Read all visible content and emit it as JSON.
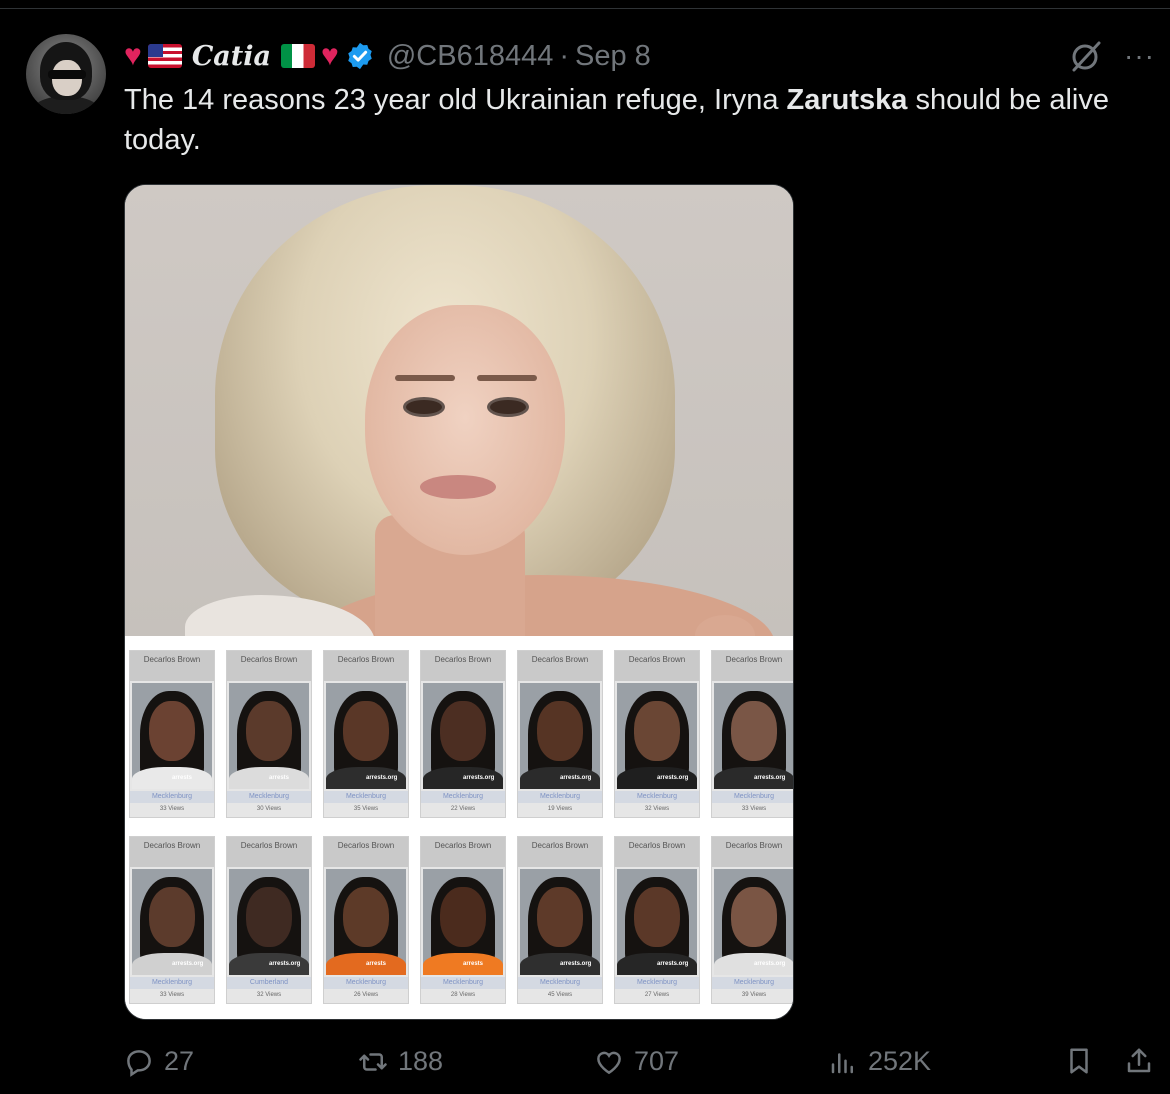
{
  "post": {
    "author_name": "Catia",
    "handle": "@CB618444",
    "separator": "·",
    "date": "Sep 8",
    "more_label": "···",
    "text_before": "The 14 reasons 23 year old Ukrainian refuge, Iryna ",
    "text_bold": "Zarutska",
    "text_after": " should be alive today."
  },
  "mugshots": [
    {
      "label": "Decarlos Brown",
      "watermark": "arrests",
      "county": "Mecklenburg",
      "views": "33 Views",
      "skin": "#6b4232",
      "shirt": "#e9e9e9"
    },
    {
      "label": "Decarlos Brown",
      "watermark": "arrests",
      "county": "Mecklenburg",
      "views": "30 Views",
      "skin": "#5b3a2b",
      "shirt": "#dcdcdc"
    },
    {
      "label": "Decarlos Brown",
      "watermark": "arrests.org",
      "county": "Mecklenburg",
      "views": "35 Views",
      "skin": "#5a3727",
      "shirt": "#2d2d2d"
    },
    {
      "label": "Decarlos Brown",
      "watermark": "arrests.org",
      "county": "Mecklenburg",
      "views": "22 Views",
      "skin": "#4c2e22",
      "shirt": "#262626"
    },
    {
      "label": "Decarlos Brown",
      "watermark": "arrests.org",
      "county": "Mecklenburg",
      "views": "19 Views",
      "skin": "#563424",
      "shirt": "#2b2b2b"
    },
    {
      "label": "Decarlos Brown",
      "watermark": "arrests.org",
      "county": "Mecklenburg",
      "views": "32 Views",
      "skin": "#6a4634",
      "shirt": "#1f1f1f"
    },
    {
      "label": "Decarlos Brown",
      "watermark": "arrests.org",
      "county": "Mecklenburg",
      "views": "33 Views",
      "skin": "#7a5646",
      "shirt": "#2a2a2a"
    },
    {
      "label": "Decarlos Brown",
      "watermark": "arrests.org",
      "county": "Mecklenburg",
      "views": "33 Views",
      "skin": "#5c3b2c",
      "shirt": "#d0d0d0"
    },
    {
      "label": "Decarlos Brown",
      "watermark": "arrests.org",
      "county": "Cumberland",
      "views": "32 Views",
      "skin": "#3f2a22",
      "shirt": "#3a3a3a"
    },
    {
      "label": "Decarlos Brown",
      "watermark": "arrests",
      "county": "Mecklenburg",
      "views": "26 Views",
      "skin": "#5d3a28",
      "shirt": "#e36a1f"
    },
    {
      "label": "Decarlos Brown",
      "watermark": "arrests",
      "county": "Mecklenburg",
      "views": "28 Views",
      "skin": "#4b2b1d",
      "shirt": "#ef7a22"
    },
    {
      "label": "Decarlos Brown",
      "watermark": "arrests.org",
      "county": "Mecklenburg",
      "views": "45 Views",
      "skin": "#5e3a29",
      "shirt": "#2f2f2f"
    },
    {
      "label": "Decarlos Brown",
      "watermark": "arrests.org",
      "county": "Mecklenburg",
      "views": "27 Views",
      "skin": "#5b3828",
      "shirt": "#262626"
    },
    {
      "label": "Decarlos Brown",
      "watermark": "arrests.org",
      "county": "Mecklenburg",
      "views": "39 Views",
      "skin": "#7a5544",
      "shirt": "#e0e0e0"
    }
  ],
  "actions": {
    "replies": "27",
    "reposts": "188",
    "likes": "707",
    "views": "252K"
  },
  "colors": {
    "background": "#000000",
    "text": "#e7e9ea",
    "muted": "#71767b",
    "verified": "#1d9bf0",
    "heart": "#e0245e"
  }
}
